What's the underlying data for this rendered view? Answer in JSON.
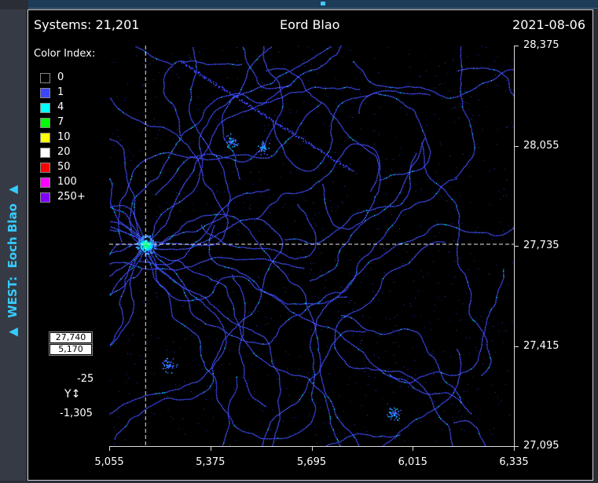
{
  "sidebar": {
    "arrow_glyph": "▲",
    "label": "WEST:  Eoch Blao"
  },
  "header": {
    "systems": "Systems: 21,201",
    "title": "Eord Blao",
    "date": "2021-08-06"
  },
  "legend": {
    "title": "Color Index:",
    "items": [
      {
        "label": "0",
        "color": "#000000"
      },
      {
        "label": "1",
        "color": "#3c46ff"
      },
      {
        "label": "4",
        "color": "#00ffff"
      },
      {
        "label": "7",
        "color": "#00ff00"
      },
      {
        "label": "10",
        "color": "#ffff00"
      },
      {
        "label": "20",
        "color": "#ffffff"
      },
      {
        "label": "50",
        "color": "#ff0000"
      },
      {
        "label": "100",
        "color": "#ff00ff"
      },
      {
        "label": "250+",
        "color": "#8000ff"
      }
    ]
  },
  "readout": {
    "y": "27,740",
    "x": "5,170"
  },
  "z_axis": {
    "top": "-25",
    "label": "Y",
    "glyph": "↕",
    "bottom": "-1,305"
  },
  "chart_data": {
    "type": "heatmap",
    "x_ticks": [
      "5,055",
      "5,375",
      "5,695",
      "6,015",
      "6,335"
    ],
    "y_ticks": [
      "28,375",
      "28,055",
      "27,735",
      "27,415",
      "27,095"
    ],
    "xlim": [
      5055,
      6335
    ],
    "ylim": [
      27095,
      28375
    ],
    "crosshair": {
      "x": 5170,
      "y": 27740
    }
  }
}
